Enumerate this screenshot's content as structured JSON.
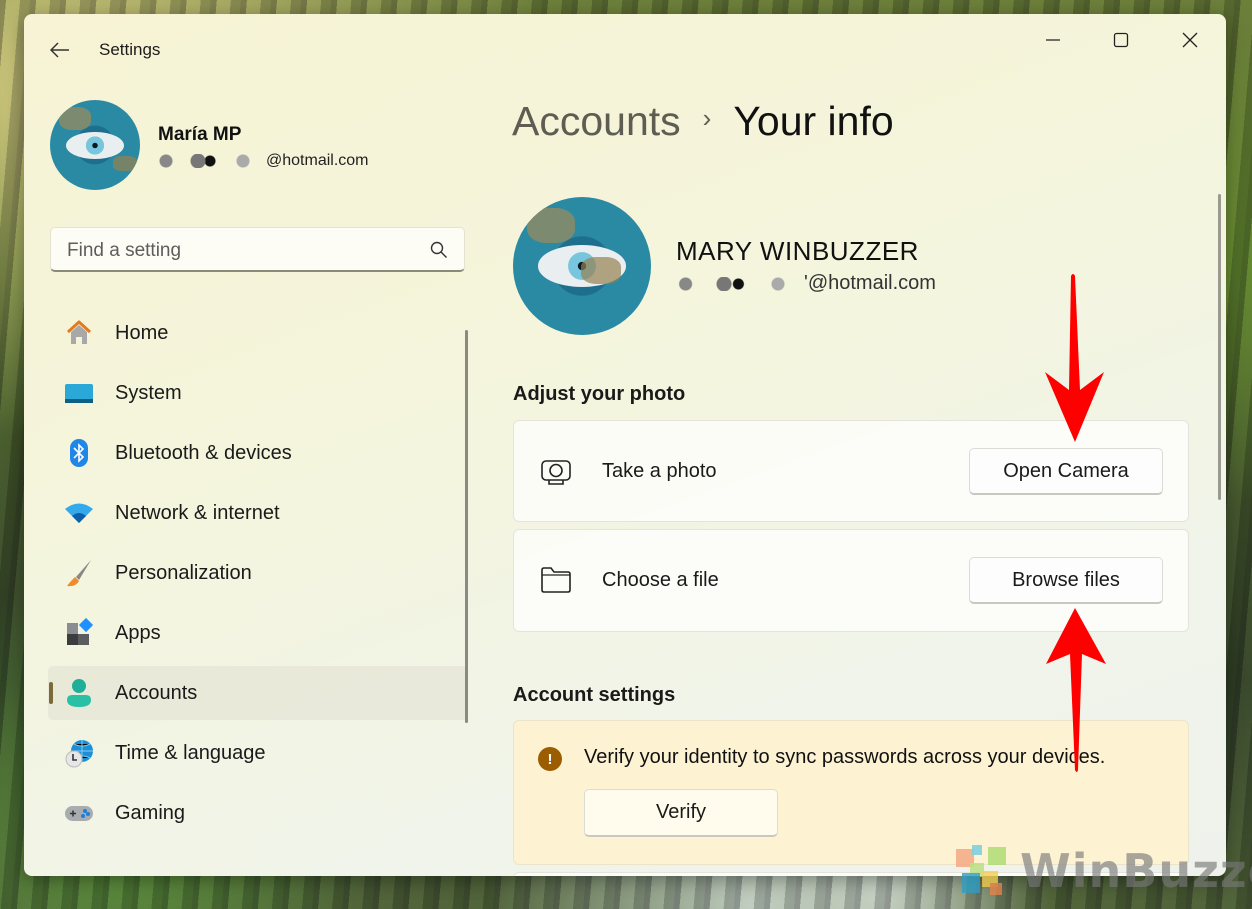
{
  "window": {
    "app_title": "Settings",
    "controls": {
      "minimize": "minimize-icon",
      "maximize": "maximize-icon",
      "close": "close-icon"
    }
  },
  "sidebar": {
    "profile": {
      "name": "María MP",
      "email": "@hotmail.com"
    },
    "search": {
      "placeholder": "Find a setting",
      "value": ""
    },
    "items": [
      {
        "label": "Home",
        "icon": "home-icon",
        "active": false
      },
      {
        "label": "System",
        "icon": "system-icon",
        "active": false
      },
      {
        "label": "Bluetooth & devices",
        "icon": "bluetooth-icon",
        "active": false
      },
      {
        "label": "Network & internet",
        "icon": "wifi-icon",
        "active": false
      },
      {
        "label": "Personalization",
        "icon": "brush-icon",
        "active": false
      },
      {
        "label": "Apps",
        "icon": "apps-icon",
        "active": false
      },
      {
        "label": "Accounts",
        "icon": "accounts-icon",
        "active": true
      },
      {
        "label": "Time & language",
        "icon": "time-language-icon",
        "active": false
      },
      {
        "label": "Gaming",
        "icon": "gaming-icon",
        "active": false
      }
    ]
  },
  "main": {
    "breadcrumb": {
      "parent": "Accounts",
      "separator": "›",
      "current": "Your info"
    },
    "user": {
      "name": "MARY WINBUZZER",
      "email": "'@hotmail.com"
    },
    "adjust_photo": {
      "title": "Adjust your photo",
      "rows": [
        {
          "label": "Take a photo",
          "icon": "camera-icon",
          "button": "Open Camera"
        },
        {
          "label": "Choose a file",
          "icon": "folder-icon",
          "button": "Browse files"
        }
      ]
    },
    "account_settings": {
      "title": "Account settings",
      "warning": {
        "icon_glyph": "!",
        "text": "Verify your identity to sync passwords across your devices.",
        "button": "Verify"
      }
    }
  },
  "annotations": {
    "arrow_color": "#ff0000"
  },
  "watermark": {
    "text": "WinBuzzer"
  }
}
